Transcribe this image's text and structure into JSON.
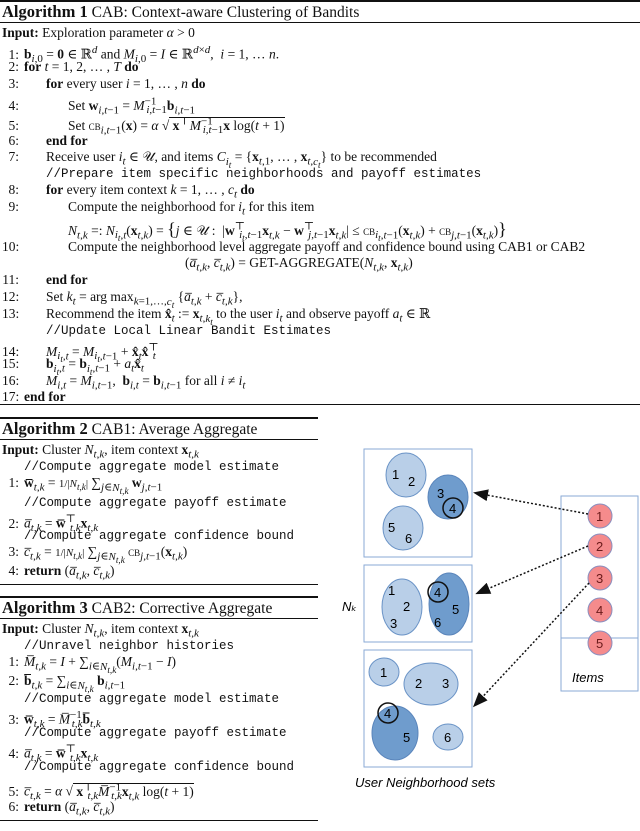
{
  "algorithm1": {
    "label": "Algorithm 1",
    "title": "CAB: Context-aware Clustering of Bandits",
    "input_label": "Input:",
    "input_text": "Exploration parameter α > 0",
    "lines": [
      {
        "num": "1:",
        "text": "b_{i,0} = 0 ∈ ℝ^d and M_{i,0} = I ∈ ℝ^{d×d}, i = 1,…n."
      },
      {
        "num": "2:",
        "text": "for t = 1,2,…,T do"
      },
      {
        "num": "3:",
        "text": "for every user i = 1,…,n do"
      },
      {
        "num": "4:",
        "text": "Set w_{i,t−1} = M^{−1}_{i,t−1} b_{i,t−1}"
      },
      {
        "num": "5:",
        "text": "Set CB_{i,t−1}(x) = α √(xᵀ M^{−1}_{i,t−1} x log(t+1))"
      },
      {
        "num": "6:",
        "text": "end for"
      },
      {
        "num": "7:",
        "text": "Receive user i_t ∈ 𝒰, and items C_{i_t} = {x_{t,1},…,x_{t,c_t}} to be recommended"
      },
      {
        "num": "",
        "text": "//Prepare item specific neighborhoods and payoff estimates"
      },
      {
        "num": "8:",
        "text": "for every item context k = 1,…,c_t do"
      },
      {
        "num": "9:",
        "text": "Compute the neighborhood for i_t for this item"
      },
      {
        "num": "",
        "text": "N_{t,k} =: N_{i_t,t}(x_{t,k}) = { j ∈ 𝒰 : |wᵀ_{i_t,t−1}x_{t,k} − wᵀ_{j,t−1}x_{t,k}| ≤ CB_{i_t,t−1}(x_{t,k}) + CB_{j,t−1}(x_{t,k}) }"
      },
      {
        "num": "10:",
        "text": "Compute the neighborhood level aggregate payoff and confidence bound using CAB1 or CAB2"
      },
      {
        "num": "",
        "text": "(ā_{t,k}, c̄_{t,k}) = GET-AGGREGATE(N_{t,k}, x_{t,k})"
      },
      {
        "num": "11:",
        "text": "end for"
      },
      {
        "num": "12:",
        "text": "Set k_t = arg max_{k=1,…,c_t} {ā_{t,k} + c̄_{t,k}},"
      },
      {
        "num": "13:",
        "text": "Recommend the item x̂_t := x_{t,k_t} to the user i_t and observe payoff a_t ∈ ℝ"
      },
      {
        "num": "",
        "text": "//Update Local Linear Bandit Estimates"
      },
      {
        "num": "14:",
        "text": "M_{i_t,t} = M_{i_t,t−1} + x̂_t x̂_tᵀ"
      },
      {
        "num": "15:",
        "text": "b_{i_t,t} = b_{i_t,t−1} + a_t x̂_t"
      },
      {
        "num": "16:",
        "text": "M_{i,t} = M_{i,t−1}, b_{i,t} = b_{i,t−1} for all i ≠ i_t"
      },
      {
        "num": "17:",
        "text": "end for"
      }
    ]
  },
  "algorithm2": {
    "label": "Algorithm 2",
    "title": "CAB1: Average Aggregate",
    "input_label": "Input:",
    "input_text": "Cluster N_{t,k}, item context x_{t,k}",
    "lines": [
      {
        "num": "",
        "text": "//Compute aggregate model estimate"
      },
      {
        "num": "1:",
        "text": "w̄_{t,k} = 1/|N_{t,k}| Σ_{j∈N_{t,k}} w_{j,t−1}"
      },
      {
        "num": "",
        "text": "//Compute aggregate payoff estimate"
      },
      {
        "num": "2:",
        "text": "ā_{t,k} = w̄ᵀ_{t,k} x_{t,k}"
      },
      {
        "num": "",
        "text": "//Compute aggregate confidence bound"
      },
      {
        "num": "3:",
        "text": "c̄_{t,k} = 1/|N_{t,k}| Σ_{j∈N_{t,k}} CB_{j,t−1}(x_{t,k})"
      },
      {
        "num": "4:",
        "text": "return (ā_{t,k}, c̄_{t,k})"
      }
    ]
  },
  "algorithm3": {
    "label": "Algorithm 3",
    "title": "CAB2: Corrective Aggregate",
    "input_label": "Input:",
    "input_text": "Cluster N_{t,k}, item context x_{t,k}",
    "lines": [
      {
        "num": "",
        "text": "//Unravel neighbor histories"
      },
      {
        "num": "1:",
        "text": "M̄_{t,k} = I + Σ_{i∈N_{t,k}} (M_{i,t−1} − I)"
      },
      {
        "num": "2:",
        "text": "b̄_{t,k} = Σ_{i∈N_{t,k}} b_{i,t−1}"
      },
      {
        "num": "",
        "text": "//Compute aggregate model estimate"
      },
      {
        "num": "3:",
        "text": "w̄_{t,k} = M̄^{−1}_{t,k} b̄_{t,k}"
      },
      {
        "num": "",
        "text": "//Compute aggregate payoff estimate"
      },
      {
        "num": "4:",
        "text": "ā_{t,k} = w̄ᵀ_{t,k} x_{t,k}"
      },
      {
        "num": "",
        "text": "//Compute aggregate confidence bound"
      },
      {
        "num": "5:",
        "text": "c̄_{t,k} = α √(xᵀ_{t,k} M̄^{−1}_{t,k} x_{t,k} log(t+1))"
      },
      {
        "num": "6:",
        "text": "return (ā_{t,k}, c̄_{t,k})"
      }
    ]
  },
  "diagram": {
    "nk_label": "Nₖ",
    "items_label": "Items",
    "caption": "User Neighborhood sets",
    "items": [
      "1",
      "2",
      "3",
      "4",
      "5"
    ],
    "panel1": {
      "light_a": [
        "1",
        "2"
      ],
      "dark": [
        "3",
        "4"
      ],
      "light_b": [
        "5",
        "6"
      ],
      "circled": "4"
    },
    "panel2": {
      "light": [
        "1",
        "2",
        "3"
      ],
      "dark": [
        "4",
        "5",
        "6"
      ],
      "circled": "4"
    },
    "panel3": {
      "small_a": [
        "1"
      ],
      "light": [
        "2",
        "3"
      ],
      "dark": [
        "4",
        "5"
      ],
      "small_b": [
        "6"
      ],
      "circled": "4"
    },
    "colors": {
      "light_ellipse": "#b9cfe8",
      "dark_ellipse": "#6f9ccd",
      "ellipse_stroke": "#6a93c6",
      "item_fill": "#f58b8c",
      "item_stroke": "#8a8fbf",
      "panel_stroke": "#8aaad6"
    }
  }
}
